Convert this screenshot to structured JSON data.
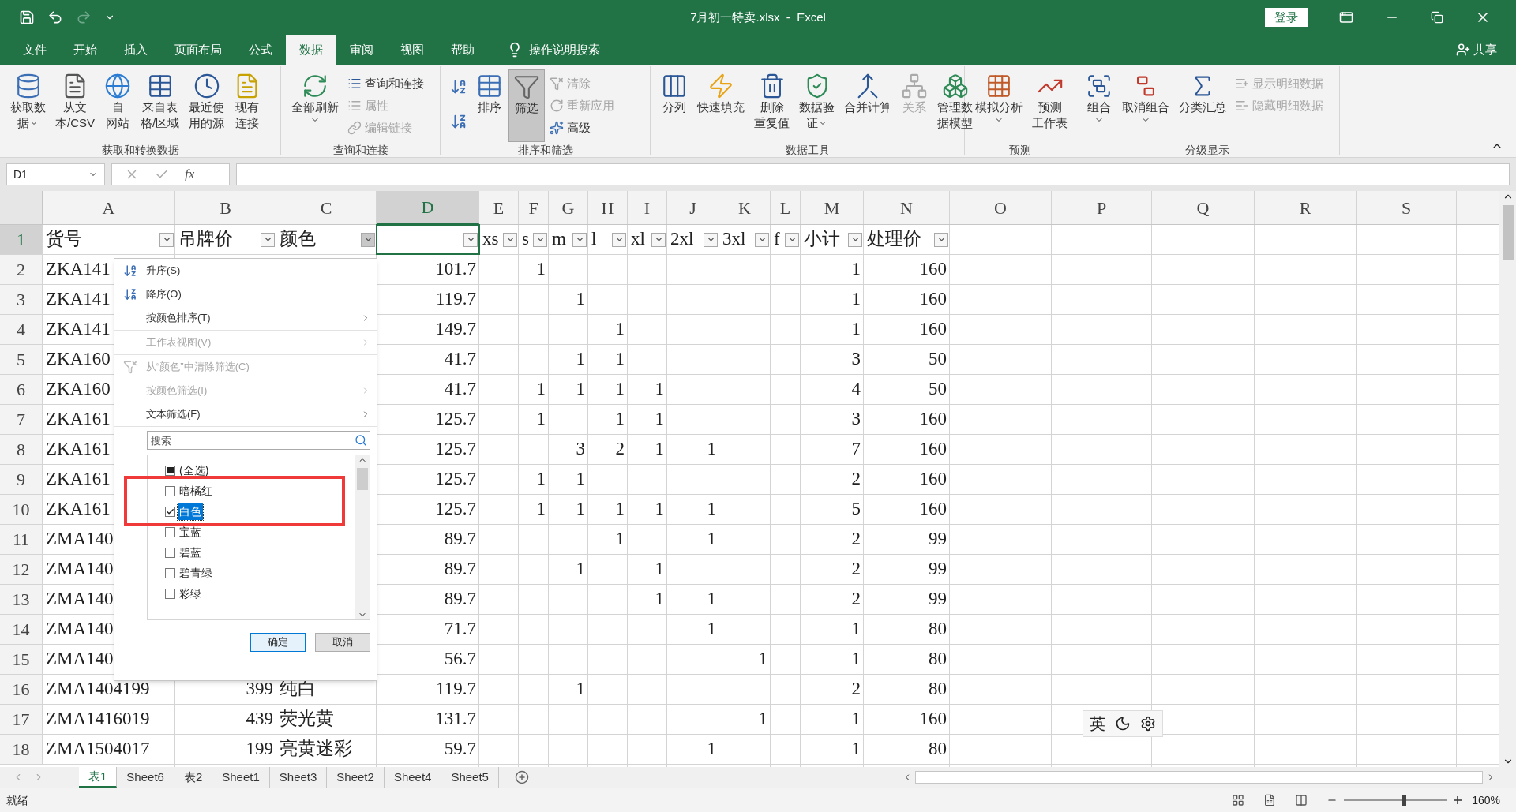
{
  "window": {
    "title": "7月初一特卖.xlsx  -  Excel",
    "login_button": "登录"
  },
  "menu_tabs": [
    {
      "label": "文件",
      "selected": false
    },
    {
      "label": "开始",
      "selected": false
    },
    {
      "label": "插入",
      "selected": false
    },
    {
      "label": "页面布局",
      "selected": false
    },
    {
      "label": "公式",
      "selected": false
    },
    {
      "label": "数据",
      "selected": true
    },
    {
      "label": "审阅",
      "selected": false
    },
    {
      "label": "视图",
      "selected": false
    },
    {
      "label": "帮助",
      "selected": false
    }
  ],
  "tell_me": "操作说明搜索",
  "share": "共享",
  "ribbon": [
    {
      "label": "获取和转换数据",
      "buttons": [
        {
          "kind": "large",
          "lines": [
            "获取数",
            "据"
          ],
          "dropdown": true,
          "disabled": false
        },
        {
          "kind": "large",
          "lines": [
            "从文",
            "本/CSV"
          ],
          "dropdown": false,
          "disabled": false
        },
        {
          "kind": "large",
          "lines": [
            "自",
            "网站"
          ],
          "dropdown": false,
          "disabled": false
        },
        {
          "kind": "large",
          "lines": [
            "来自表",
            "格/区域"
          ],
          "dropdown": false,
          "disabled": false
        },
        {
          "kind": "large",
          "lines": [
            "最近使",
            "用的源"
          ],
          "dropdown": false,
          "disabled": false
        },
        {
          "kind": "large",
          "lines": [
            "现有",
            "连接"
          ],
          "dropdown": false,
          "disabled": false
        }
      ]
    },
    {
      "buttons": [
        {
          "kind": "large",
          "lines": [
            "全部刷新"
          ],
          "dropdown": true,
          "disabled": false
        },
        {
          "kind": "small",
          "lines": [
            "查询和连接"
          ],
          "disabled": false
        },
        {
          "kind": "small",
          "lines": [
            "属性"
          ],
          "disabled": true
        },
        {
          "kind": "small",
          "lines": [
            "编辑链接"
          ],
          "disabled": true
        }
      ],
      "label": "查询和连接"
    },
    {
      "label": "排序和筛选",
      "buttons": [
        {
          "kind": "icon",
          "disabled": false
        },
        {
          "kind": "icon",
          "disabled": false
        },
        {
          "kind": "large",
          "lines": [
            "排序"
          ],
          "dropdown": false,
          "disabled": false
        },
        {
          "kind": "large",
          "lines": [
            "筛选"
          ],
          "dropdown": false,
          "disabled": false,
          "selected": true
        },
        {
          "kind": "small",
          "lines": [
            "清除"
          ],
          "disabled": true
        },
        {
          "kind": "small",
          "lines": [
            "重新应用"
          ],
          "disabled": true
        },
        {
          "kind": "small",
          "lines": [
            "高级"
          ],
          "disabled": false
        }
      ]
    },
    {
      "label": "数据工具",
      "buttons": [
        {
          "kind": "large",
          "lines": [
            "分列"
          ],
          "dropdown": false,
          "disabled": false
        },
        {
          "kind": "large",
          "lines": [
            "快速填充"
          ],
          "dropdown": false,
          "disabled": false
        },
        {
          "kind": "large",
          "lines": [
            "删除",
            "重复值"
          ],
          "dropdown": false,
          "disabled": false
        },
        {
          "kind": "large",
          "lines": [
            "数据验",
            "证"
          ],
          "dropdown": true,
          "disabled": false
        },
        {
          "kind": "large",
          "lines": [
            "合并计算"
          ],
          "dropdown": false,
          "disabled": false
        },
        {
          "kind": "large",
          "lines": [
            "关系"
          ],
          "dropdown": false,
          "disabled": true
        },
        {
          "kind": "large",
          "lines": [
            "管理数",
            "据模型"
          ],
          "dropdown": false,
          "disabled": false
        }
      ]
    },
    {
      "label": "预测",
      "buttons": [
        {
          "kind": "large",
          "lines": [
            "模拟分析"
          ],
          "dropdown": true,
          "disabled": false
        },
        {
          "kind": "large",
          "lines": [
            "预测",
            "工作表"
          ],
          "dropdown": false,
          "disabled": false
        }
      ]
    },
    {
      "label": "分级显示",
      "buttons": [
        {
          "kind": "large",
          "lines": [
            "组合"
          ],
          "dropdown": true,
          "disabled": false
        },
        {
          "kind": "large",
          "lines": [
            "取消组合"
          ],
          "dropdown": true,
          "disabled": false
        },
        {
          "kind": "large",
          "lines": [
            "分类汇总"
          ],
          "dropdown": false,
          "disabled": false
        },
        {
          "kind": "small",
          "lines": [
            "显示明细数据"
          ],
          "disabled": true
        },
        {
          "kind": "small",
          "lines": [
            "隐藏明细数据"
          ],
          "disabled": true
        }
      ]
    }
  ],
  "formula_bar": {
    "name_box": "D1",
    "fx": "fx"
  },
  "columns": [
    {
      "label": "A",
      "selected": false
    },
    {
      "label": "B",
      "selected": false
    },
    {
      "label": "C",
      "selected": false
    },
    {
      "label": "D",
      "selected": true
    },
    {
      "label": "E",
      "selected": false
    },
    {
      "label": "F",
      "selected": false
    },
    {
      "label": "G",
      "selected": false
    },
    {
      "label": "H",
      "selected": false
    },
    {
      "label": "I",
      "selected": false
    },
    {
      "label": "J",
      "selected": false
    },
    {
      "label": "K",
      "selected": false
    },
    {
      "label": "L",
      "selected": false
    },
    {
      "label": "M",
      "selected": false
    },
    {
      "label": "N",
      "selected": false
    },
    {
      "label": "O",
      "selected": false
    },
    {
      "label": "P",
      "selected": false
    },
    {
      "label": "Q",
      "selected": false
    },
    {
      "label": "R",
      "selected": false
    },
    {
      "label": "S",
      "selected": false
    }
  ],
  "rows": [
    {
      "num": "1",
      "selected": true,
      "kind": "header",
      "cells": {
        "A": "货号",
        "B": "吊牌价",
        "C": "颜色",
        "E": "xs",
        "F": "s",
        "G": "m",
        "H": "l",
        "I": "xl",
        "J": "2xl",
        "K": "3xl",
        "L": "f",
        "M": "小计",
        "N": "处理价"
      }
    },
    {
      "num": "2",
      "selected": false,
      "kind": "data",
      "cells": {
        "A": "ZKA141",
        "D": "101.7",
        "F": "1",
        "M": "1",
        "N": "160"
      }
    },
    {
      "num": "3",
      "selected": false,
      "kind": "data",
      "cells": {
        "A": "ZKA141",
        "D": "119.7",
        "G": "1",
        "M": "1",
        "N": "160"
      }
    },
    {
      "num": "4",
      "selected": false,
      "kind": "data",
      "cells": {
        "A": "ZKA141",
        "D": "149.7",
        "H": "1",
        "M": "1",
        "N": "160"
      }
    },
    {
      "num": "5",
      "selected": false,
      "kind": "data",
      "cells": {
        "A": "ZKA160",
        "D": "41.7",
        "G": "1",
        "H": "1",
        "M": "3",
        "N": "50"
      }
    },
    {
      "num": "6",
      "selected": false,
      "kind": "data",
      "cells": {
        "A": "ZKA160",
        "D": "41.7",
        "F": "1",
        "G": "1",
        "H": "1",
        "I": "1",
        "M": "4",
        "N": "50"
      }
    },
    {
      "num": "7",
      "selected": false,
      "kind": "data",
      "cells": {
        "A": "ZKA161",
        "D": "125.7",
        "F": "1",
        "H": "1",
        "I": "1",
        "M": "3",
        "N": "160"
      }
    },
    {
      "num": "8",
      "selected": false,
      "kind": "data",
      "cells": {
        "A": "ZKA161",
        "D": "125.7",
        "G": "3",
        "H": "2",
        "I": "1",
        "J": "1",
        "M": "7",
        "N": "160"
      }
    },
    {
      "num": "9",
      "selected": false,
      "kind": "data",
      "cells": {
        "A": "ZKA161",
        "D": "125.7",
        "F": "1",
        "G": "1",
        "M": "2",
        "N": "160"
      }
    },
    {
      "num": "10",
      "selected": false,
      "kind": "data",
      "cells": {
        "A": "ZKA161",
        "D": "125.7",
        "F": "1",
        "G": "1",
        "H": "1",
        "I": "1",
        "J": "1",
        "M": "5",
        "N": "160"
      }
    },
    {
      "num": "11",
      "selected": false,
      "kind": "data",
      "cells": {
        "A": "ZMA140",
        "D": "89.7",
        "H": "1",
        "J": "1",
        "M": "2",
        "N": "99"
      }
    },
    {
      "num": "12",
      "selected": false,
      "kind": "data",
      "cells": {
        "A": "ZMA140",
        "D": "89.7",
        "G": "1",
        "I": "1",
        "M": "2",
        "N": "99"
      }
    },
    {
      "num": "13",
      "selected": false,
      "kind": "data",
      "cells": {
        "A": "ZMA140",
        "D": "89.7",
        "I": "1",
        "J": "1",
        "M": "2",
        "N": "99"
      }
    },
    {
      "num": "14",
      "selected": false,
      "kind": "data",
      "cells": {
        "A": "ZMA140",
        "D": "71.7",
        "J": "1",
        "M": "1",
        "N": "80"
      }
    },
    {
      "num": "15",
      "selected": false,
      "kind": "data",
      "cells": {
        "A": "ZMA140",
        "D": "56.7",
        "K": "1",
        "M": "1",
        "N": "80"
      }
    },
    {
      "num": "16",
      "selected": false,
      "kind": "data",
      "cells": {
        "A": "ZMA1404199",
        "B": "399",
        "C": "纯白",
        "D": "119.7",
        "G": "1",
        "M": "2",
        "N": "80"
      }
    },
    {
      "num": "17",
      "selected": false,
      "kind": "data",
      "cells": {
        "A": "ZMA1416019",
        "B": "439",
        "C": "荧光黄",
        "D": "131.7",
        "K": "1",
        "M": "1",
        "N": "160"
      }
    },
    {
      "num": "18",
      "selected": false,
      "kind": "data",
      "cells": {
        "A": "ZMA1504017",
        "B": "199",
        "C": "亮黄迷彩",
        "D": "59.7",
        "J": "1",
        "M": "1",
        "N": "80"
      }
    }
  ],
  "filter_menu": {
    "items": [
      {
        "label": "升序(S)",
        "kind": "sort_asc",
        "disabled": false,
        "submenu": false,
        "divider_after": false
      },
      {
        "label": "降序(O)",
        "kind": "sort_desc",
        "disabled": false,
        "submenu": false,
        "divider_after": false
      },
      {
        "label": "按颜色排序(T)",
        "kind": "plain",
        "disabled": false,
        "submenu": true,
        "divider_after": true
      },
      {
        "label": "工作表视图(V)",
        "kind": "plain",
        "disabled": true,
        "submenu": true,
        "divider_after": true
      },
      {
        "label": "从“颜色”中清除筛选(C)",
        "kind": "clear",
        "disabled": true,
        "submenu": false,
        "divider_after": false
      },
      {
        "label": "按颜色筛选(I)",
        "kind": "plain",
        "disabled": true,
        "submenu": true,
        "divider_after": false
      },
      {
        "label": "文本筛选(F)",
        "kind": "plain",
        "disabled": false,
        "submenu": true,
        "divider_after": true
      }
    ],
    "search_placeholder": "搜索",
    "values": [
      {
        "label": "(全选)",
        "checked": false,
        "mixed": true,
        "selected": false
      },
      {
        "label": "暗橘红",
        "checked": false,
        "mixed": false,
        "selected": false
      },
      {
        "label": "白色",
        "checked": true,
        "mixed": false,
        "selected": true
      },
      {
        "label": "宝蓝",
        "checked": false,
        "mixed": false,
        "selected": false
      },
      {
        "label": "碧蓝",
        "checked": false,
        "mixed": false,
        "selected": false
      },
      {
        "label": "碧青绿",
        "checked": false,
        "mixed": false,
        "selected": false
      },
      {
        "label": "彩绿",
        "checked": false,
        "mixed": false,
        "selected": false
      }
    ],
    "ok_button": "确定",
    "cancel_button": "取消"
  },
  "ime": {
    "label": "英"
  },
  "sheet_tabs": [
    {
      "label": "表1",
      "selected": true
    },
    {
      "label": "Sheet6",
      "selected": false
    },
    {
      "label": "表2",
      "selected": false
    },
    {
      "label": "Sheet1",
      "selected": false
    },
    {
      "label": "Sheet3",
      "selected": false
    },
    {
      "label": "Sheet2",
      "selected": false
    },
    {
      "label": "Sheet4",
      "selected": false
    },
    {
      "label": "Sheet5",
      "selected": false
    }
  ],
  "status_bar": {
    "status": "就绪",
    "zoom": "160%",
    "zoom_slider": {
      "level": 0.58
    }
  }
}
